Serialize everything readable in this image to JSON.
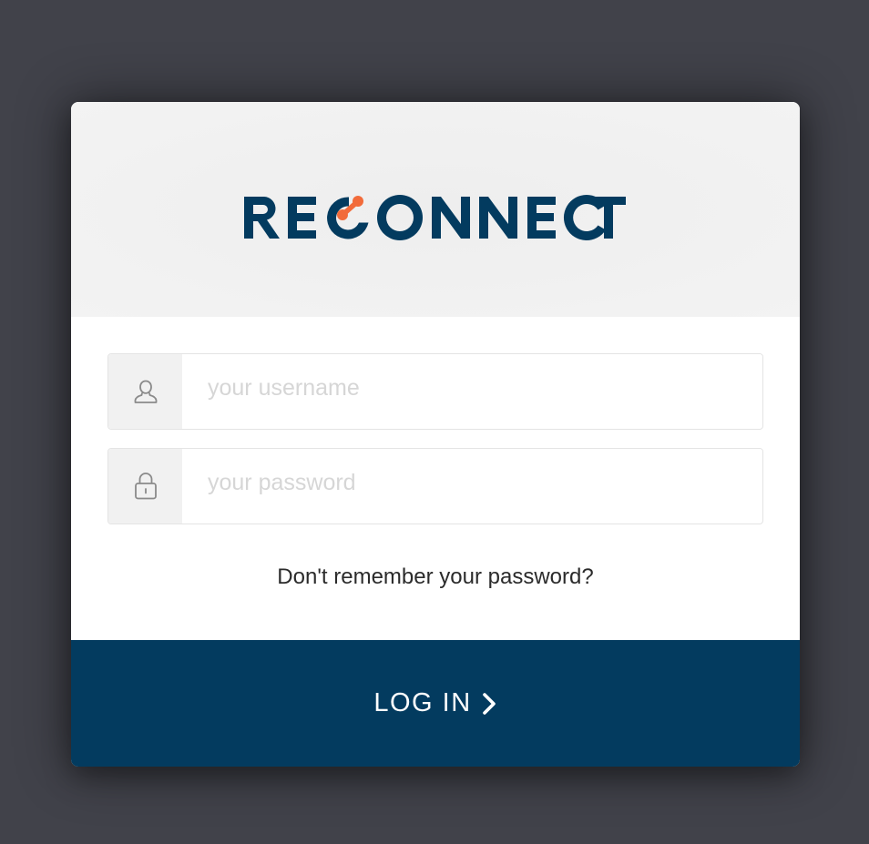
{
  "brand": {
    "name": "RECONNECT",
    "primary_color": "#033b5f",
    "accent_color": "#f26b3a"
  },
  "form": {
    "username": {
      "icon": "user-icon",
      "value": "",
      "placeholder": "your username"
    },
    "password": {
      "icon": "lock-icon",
      "value": "",
      "placeholder": "your password"
    },
    "forgot_link": "Don't remember your password?",
    "submit_label": "LOG IN",
    "submit_icon": "chevron-right-icon"
  }
}
